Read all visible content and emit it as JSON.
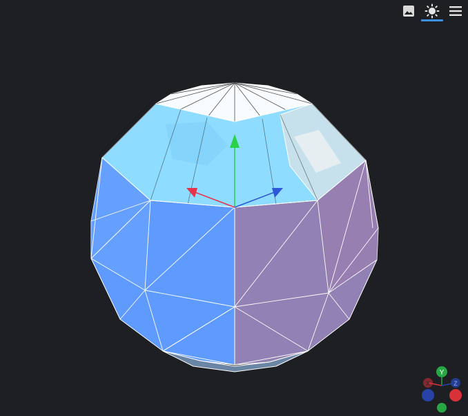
{
  "toolbar": {
    "buttons": [
      {
        "icon": "image-icon",
        "active": false
      },
      {
        "icon": "sun-icon",
        "active": true
      },
      {
        "icon": "menu-icon",
        "active": false
      }
    ]
  },
  "scene": {
    "object": "faceted-sphere-mesh",
    "colors": {
      "background": "#1e1f22",
      "top_cap": "#ffffff",
      "upper_band": "#8fdcff",
      "upper_band_right": "#c9e3ee",
      "lower_left": "#5f9bff",
      "lower_right": "#9181b4",
      "wireframe": "#ffffff",
      "axis_x": "#e8344a",
      "axis_y": "#2bd14a",
      "axis_z": "#2c57d6"
    }
  },
  "orientation_gizmo": {
    "labels": {
      "x": "X",
      "y": "Y",
      "z": "Z"
    },
    "colors": {
      "x": "#d8313a",
      "y": "#28a745",
      "z": "#2743a8"
    }
  }
}
